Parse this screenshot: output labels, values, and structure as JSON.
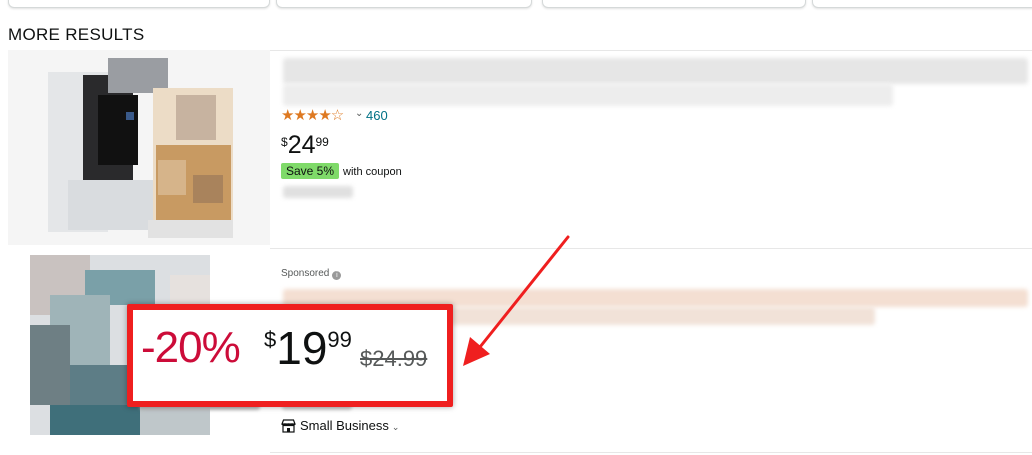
{
  "section": {
    "title": "MORE RESULTS"
  },
  "product1": {
    "stars_display": "★★★★☆",
    "rating_value": 4.0,
    "rating_count": "460",
    "price": {
      "symbol": "$",
      "whole": "24",
      "fraction": "99"
    },
    "coupon_badge": "Save 5%",
    "coupon_text": "with coupon"
  },
  "product2": {
    "sponsored_label": "Sponsored",
    "info_icon": "i",
    "small_business_label": "Small Business"
  },
  "callout": {
    "discount": "-20%",
    "price": {
      "symbol": "$",
      "whole": "19",
      "fraction": "99"
    },
    "list_price": "$24.99"
  },
  "colors": {
    "star": "#de7921",
    "link": "#007185",
    "coupon_bg": "#7fda69",
    "discount": "#cc0c39",
    "callout_border": "#ef1f1f"
  },
  "icons": {
    "star": "star-icon",
    "chevron": "chevron-down-icon",
    "info": "info-icon",
    "store": "store-icon"
  }
}
